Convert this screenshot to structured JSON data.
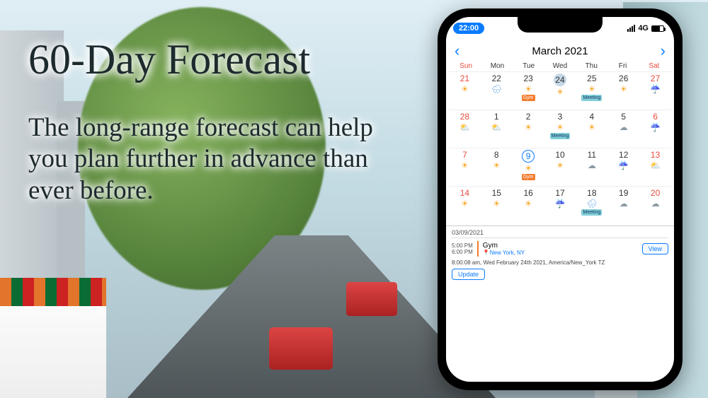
{
  "headline": {
    "title": "60-Day Forecast",
    "subtitle": "The long-range forecast can help you plan further in advance than ever before."
  },
  "statusbar": {
    "time": "22:00",
    "network": "4G"
  },
  "nav": {
    "title": "March 2021"
  },
  "weekdays": [
    "Sun",
    "Mon",
    "Tue",
    "Wed",
    "Thu",
    "Fri",
    "Sat"
  ],
  "weeks": [
    [
      {
        "n": "21",
        "red": true,
        "wx": "sun"
      },
      {
        "n": "22",
        "wx": "droprain"
      },
      {
        "n": "23",
        "wx": "sun",
        "evt": "gym"
      },
      {
        "n": "24",
        "wx": "sun",
        "today": true
      },
      {
        "n": "25",
        "wx": "sun",
        "evt": "meeting"
      },
      {
        "n": "26",
        "wx": "sun"
      },
      {
        "n": "27",
        "red": true,
        "wx": "rain"
      }
    ],
    [
      {
        "n": "28",
        "red": true,
        "wx": "partly"
      },
      {
        "n": "1",
        "wx": "partly"
      },
      {
        "n": "2",
        "wx": "sun"
      },
      {
        "n": "3",
        "wx": "sun",
        "evt": "meeting"
      },
      {
        "n": "4",
        "wx": "sun"
      },
      {
        "n": "5",
        "wx": "cloud"
      },
      {
        "n": "6",
        "red": true,
        "wx": "rain"
      }
    ],
    [
      {
        "n": "7",
        "red": true,
        "wx": "sun"
      },
      {
        "n": "8",
        "wx": "sun"
      },
      {
        "n": "9",
        "wx": "sun",
        "evt": "gym",
        "selected": true
      },
      {
        "n": "10",
        "wx": "sun"
      },
      {
        "n": "11",
        "wx": "cloud"
      },
      {
        "n": "12",
        "wx": "rain"
      },
      {
        "n": "13",
        "red": true,
        "wx": "partly"
      }
    ],
    [
      {
        "n": "14",
        "red": true,
        "wx": "sun"
      },
      {
        "n": "15",
        "wx": "sun"
      },
      {
        "n": "16",
        "wx": "sun"
      },
      {
        "n": "17",
        "wx": "rain"
      },
      {
        "n": "18",
        "wx": "droprain",
        "evt": "meeting"
      },
      {
        "n": "19",
        "wx": "cloud"
      },
      {
        "n": "20",
        "red": true,
        "wx": "cloud"
      }
    ]
  ],
  "event_labels": {
    "gym": "Gym",
    "meeting": "Meeting"
  },
  "wx_glyph": {
    "sun": "☀",
    "rain": "☔",
    "cloud": "☁",
    "partly": "⛅",
    "droprain": "🌧"
  },
  "detail": {
    "date": "03/09/2021",
    "start": "5:00 PM",
    "end": "6:00 PM",
    "title": "Gym",
    "location": "New York, NY",
    "view": "View",
    "timestamp": "8:00:08 am, Wed February 24th 2021, America/New_York TZ",
    "update": "Update"
  }
}
